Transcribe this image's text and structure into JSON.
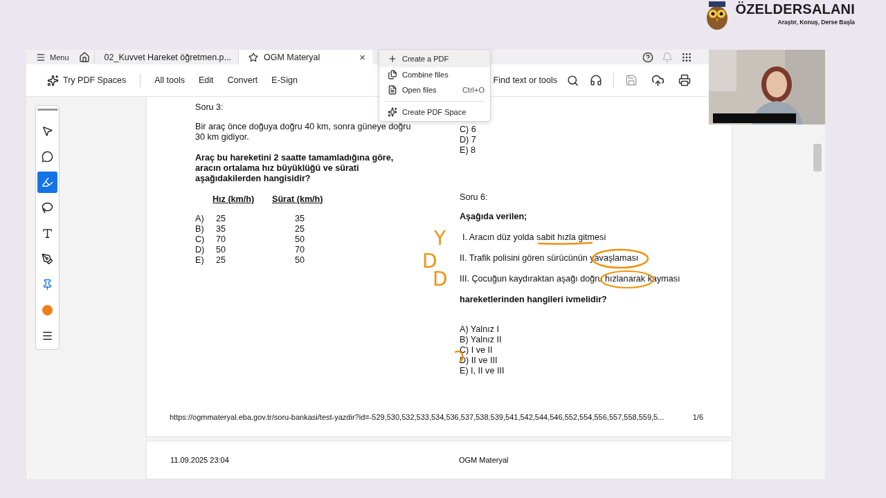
{
  "brand": {
    "name": "ÖZELDERSALANI",
    "tagline": "Araştır, Konuş, Derse Başla"
  },
  "tab_bar": {
    "menu": "Menu",
    "tabs": [
      {
        "label": "02_Kuvvet Hareket öğretmen.p...",
        "selected": false
      },
      {
        "label": "OGM Materyal",
        "selected": true,
        "close": "×"
      }
    ]
  },
  "toolbar": {
    "spaces": "Try PDF Spaces",
    "menus": [
      "All tools",
      "Edit",
      "Convert",
      "E-Sign"
    ],
    "search": "Find text or tools"
  },
  "dropdown": {
    "items": [
      {
        "label": "Create a PDF",
        "selected": true
      },
      {
        "label": "Combine files",
        "selected": false
      },
      {
        "label": "Open files",
        "shortcut": "Ctrl+O",
        "selected": false
      },
      {
        "label": "Create PDF Space",
        "selected": false
      }
    ]
  },
  "tools": [
    {
      "selected": false
    },
    {
      "selected": false
    },
    {
      "selected": true
    },
    {
      "selected": false
    },
    {
      "selected": false
    },
    {
      "selected": false
    },
    {
      "selected": false
    },
    {
      "selected": false
    },
    {
      "selected": false
    }
  ],
  "page": {
    "left_column": {
      "title": "Soru 3:",
      "text": "Bir araç önce doğuya doğru 40 km, sonra güneye doğru 30 km gidiyor.",
      "question": "Araç bu hareketini 2 saatte tamamladığına göre, aracın ortalama hız büyüklüğü ve sürati aşağıdakilerden hangisidir?",
      "columns": [
        "Hız (km/h)",
        "Sürat (km/h)"
      ],
      "rows": [
        {
          "label": "A)",
          "velocity": "25",
          "speed": "35"
        },
        {
          "label": "B)",
          "velocity": "35",
          "speed": "25"
        },
        {
          "label": "C)",
          "velocity": "70",
          "speed": "50"
        },
        {
          "label": "D)",
          "velocity": "50",
          "speed": "70"
        },
        {
          "label": "E)",
          "velocity": "25",
          "speed": "50"
        }
      ]
    },
    "right_column": {
      "prev_options": [
        "C) 6",
        "D) 7",
        "E) 8"
      ],
      "title": "Soru 6:",
      "intro": "Aşağıda verilen;",
      "statements": [
        "I. Aracın düz yolda sabit hızla gitmesi",
        "II. Trafik polisini gören sürücünün yavaşlaması",
        "III. Çocuğun kaydıraktan aşağı doğru hızlanarak kayması"
      ],
      "question": "hareketlerinden hangileri ivmelidir?",
      "options": [
        "A) Yalnız I",
        "B) Yalnız II",
        "C) I ve II",
        "D) II ve III",
        "E) I, II ve III"
      ]
    },
    "footer_url": "https://ogmmateryal.eba.gov.tr/soru-bankasi/test-yazdir?id=-529,530,532,533,534,536,537,538,539,541,542,544,546,552,554,556,557,558,559,5...",
    "page_number": "1/6"
  },
  "next_page": {
    "date": "11.09.2025 23:04",
    "title": "OGM Materyal"
  },
  "annotations": {
    "marks": [
      "Y",
      "D",
      "D"
    ]
  }
}
